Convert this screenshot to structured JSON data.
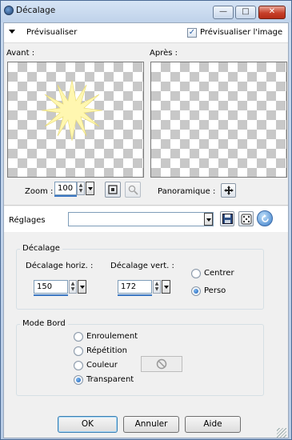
{
  "window": {
    "title": "Décalage",
    "minimize": "—",
    "maximize": "□",
    "close": "✕"
  },
  "preview": {
    "toggle_label": "Prévisualiser",
    "checkbox_label": "Prévisualiser l'image",
    "checked": true,
    "before_label": "Avant :",
    "after_label": "Après :"
  },
  "zoom": {
    "label": "Zoom :",
    "value": "100",
    "pan_label": "Panoramique :"
  },
  "presets": {
    "label": "Réglages",
    "value": ""
  },
  "offset": {
    "group_label": "Décalage",
    "horiz_label": "Décalage horiz. :",
    "horiz_value": "150",
    "vert_label": "Décalage vert. :",
    "vert_value": "172",
    "center_label": "Centrer",
    "perso_label": "Perso",
    "selected": "Perso"
  },
  "edge": {
    "group_label": "Mode Bord",
    "options": [
      "Enroulement",
      "Répétition",
      "Couleur",
      "Transparent"
    ],
    "selected": "Transparent"
  },
  "buttons": {
    "ok": "OK",
    "cancel": "Annuler",
    "help": "Aide"
  },
  "colors": {
    "accent": "#3c78c3",
    "star": "#fff7b0",
    "title_bg": "#c6d8ef"
  }
}
